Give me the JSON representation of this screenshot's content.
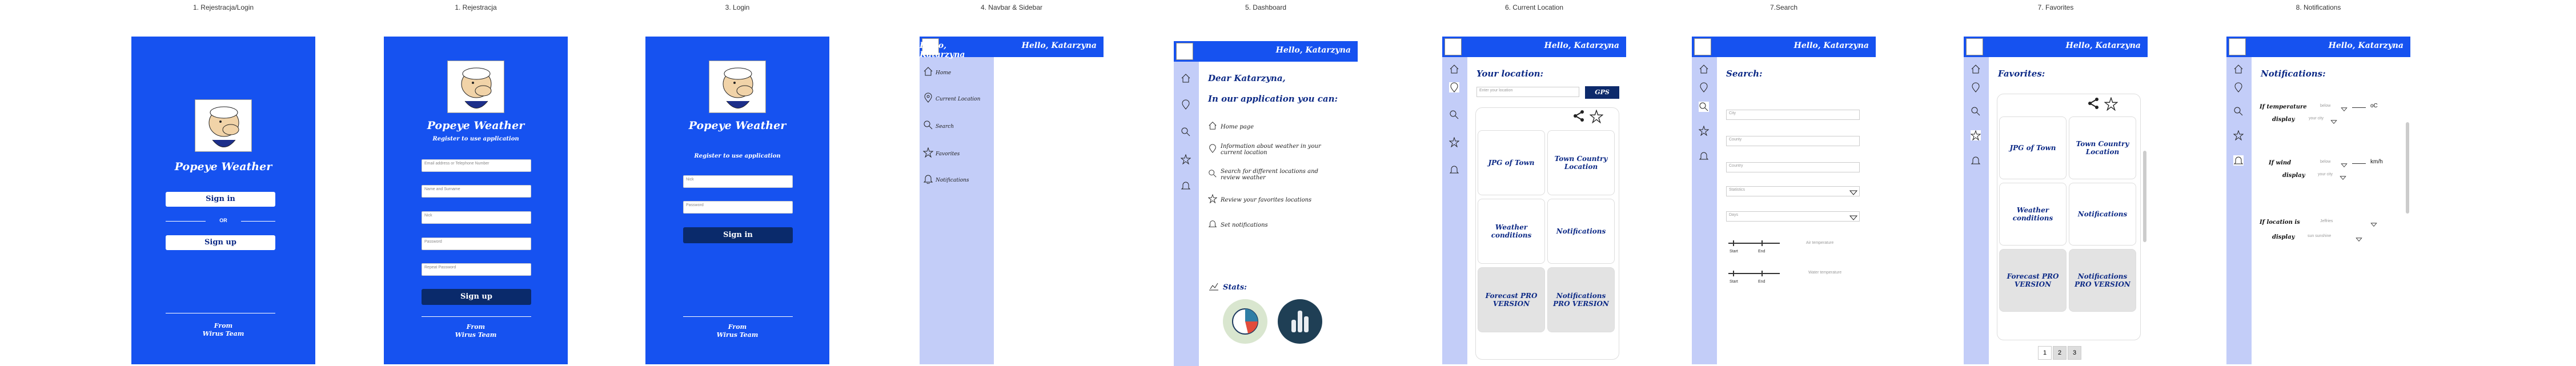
{
  "labels": [
    "1. Rejestracja/Login",
    "1. Rejestracja",
    "3. Login",
    "4. Navbar & Sidebar",
    "5. Dashboard",
    "6. Current Location",
    "7.Search",
    "7. Favorites",
    "8. Notifications"
  ],
  "brand": {
    "app_name": "Popeye Weather",
    "footer_from": "From",
    "footer_team": "Wirus Team"
  },
  "screen1": {
    "sign_in": "Sign in",
    "or": "OR",
    "sign_up": "Sign up"
  },
  "screen2": {
    "subtitle": "Register to use application",
    "fields": [
      "Email address or Telephone Number",
      "Name and Surname",
      "Nick",
      "Password",
      "Repeat Password"
    ],
    "submit": "Sign up"
  },
  "screen3": {
    "subtitle": "Register to use application",
    "fields": [
      "Nick",
      "Password"
    ],
    "submit": "Sign in"
  },
  "header": {
    "greeting": "Hello, Katarzyna"
  },
  "sidebar": {
    "items": [
      "Home",
      "Current Location",
      "Search",
      "Favorites",
      "Notifications"
    ]
  },
  "dashboard": {
    "dear": "Dear Katarzyna,",
    "intro": "In our application you can:",
    "items": [
      "Home page",
      "Information about weather in your current location",
      "Search for different locations and review weather",
      "Review your favorites locations",
      "Set notifications"
    ],
    "stats": "Stats:"
  },
  "current": {
    "title": "Your location:",
    "placeholder": "Enter your location",
    "gps": "GPS",
    "cards": [
      "JPG of Town",
      "Town Country Location",
      "Weather conditions",
      "Notifications",
      "Forecast PRO VERSION",
      "Notifications PRO VERSION"
    ]
  },
  "search": {
    "title": "Search:",
    "fields": [
      "City",
      "County",
      "Country",
      "Statistics",
      "Days"
    ],
    "slider_labels": [
      "Start",
      "End",
      "Start",
      "End"
    ],
    "slider_hints": [
      "Air temperature",
      "Water temperature"
    ]
  },
  "favorites": {
    "title": "Favorites:",
    "cards": [
      "JPG of Town",
      "Town Country Location",
      "Weather conditions",
      "Notifications",
      "Forecast PRO VERSION",
      "Notifications PRO VERSION"
    ],
    "pages": [
      "1",
      "2",
      "3"
    ]
  },
  "notifications": {
    "title": "Notifications:",
    "rows": [
      {
        "label": "If temperature",
        "op": "below",
        "unit": "oC",
        "display": "display",
        "dval": "your city"
      },
      {
        "label": "If wind",
        "op": "below",
        "unit": "km/h",
        "display": "display",
        "dval": "your city"
      },
      {
        "label": "If location is",
        "op": "Jeffries",
        "unit": "",
        "display": "display",
        "dval": "sun sunshine"
      }
    ]
  },
  "colors": {
    "brand_blue": "#1652f0",
    "dark_button": "#0a2a6b",
    "sidebar": "#c3cdf8"
  }
}
